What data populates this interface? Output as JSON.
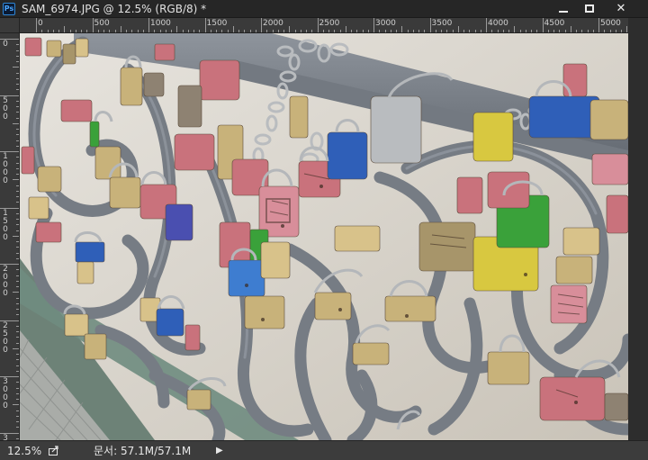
{
  "window": {
    "app_icon_text": "Ps",
    "document_title": "SAM_6974.JPG @ 12.5% (RGB/8) *",
    "minimize_icon": "minimize-icon",
    "maximize_icon": "maximize-icon",
    "close_icon": "close-icon",
    "close_glyph": "✕"
  },
  "rulers": {
    "horizontal_labels": [
      "0",
      "500",
      "1000",
      "1500",
      "2000",
      "2500",
      "3000",
      "3500",
      "4000",
      "4500",
      "5000"
    ],
    "vertical_labels": [
      "0",
      "500",
      "1000",
      "1500",
      "2000",
      "2500",
      "3000",
      "3"
    ]
  },
  "canvas": {
    "content": "photo of padlocks on a metal bridge railing"
  },
  "status": {
    "zoom": "12.5%",
    "doc_label": "문서:",
    "doc_value": "57.1M/57.1M",
    "arrow_glyph": "▶"
  },
  "colors": {
    "chrome_dark": "#262626",
    "ruler": "#3a3a3a",
    "railing": "#7a8088",
    "lock_pink": "#c9727c",
    "lock_brass": "#c8b27a",
    "lock_blue": "#2f5fb8",
    "lock_green": "#3aa13a"
  }
}
